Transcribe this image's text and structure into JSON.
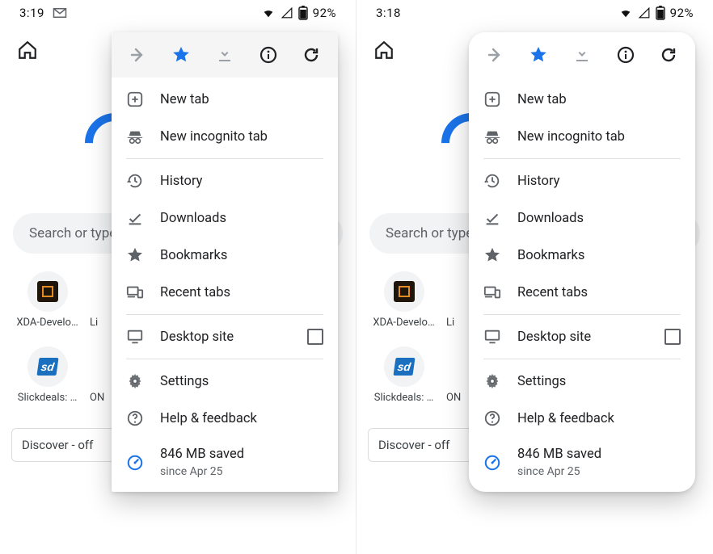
{
  "panes": [
    {
      "status": {
        "time": "3:19",
        "gmail_shown": true,
        "battery": "92%"
      },
      "menu_style": "squared"
    },
    {
      "status": {
        "time": "3:18",
        "gmail_shown": false,
        "battery": "92%"
      },
      "menu_style": "rounded"
    }
  ],
  "bg": {
    "search_placeholder": "Search or type…",
    "shortcuts": [
      {
        "label": "XDA-Develo…",
        "kind": "xda",
        "trail": "Li"
      },
      {
        "label": "Slickdeals: …",
        "kind": "sd",
        "trail": "ON"
      }
    ],
    "discover": "Discover - off"
  },
  "menu": {
    "items": [
      {
        "id": "new-tab",
        "icon": "plus-box",
        "label": "New tab"
      },
      {
        "id": "incognito",
        "icon": "incognito",
        "label": "New incognito tab"
      },
      {
        "divider": true
      },
      {
        "id": "history",
        "icon": "history",
        "label": "History"
      },
      {
        "id": "downloads",
        "icon": "download-done",
        "label": "Downloads"
      },
      {
        "id": "bookmarks",
        "icon": "star-solid",
        "label": "Bookmarks"
      },
      {
        "id": "recent-tabs",
        "icon": "devices",
        "label": "Recent tabs"
      },
      {
        "divider": true
      },
      {
        "id": "desktop-site",
        "icon": "monitor",
        "label": "Desktop site",
        "checkbox": true
      },
      {
        "divider": true
      },
      {
        "id": "settings",
        "icon": "gear",
        "label": "Settings"
      },
      {
        "id": "help",
        "icon": "help",
        "label": "Help & feedback"
      },
      {
        "id": "data-saver",
        "icon": "gauge-blue",
        "label": "846 MB saved",
        "sub": "since Apr 25"
      }
    ],
    "iconrow": [
      "forward",
      "star-active",
      "download-top",
      "info",
      "refresh"
    ]
  }
}
